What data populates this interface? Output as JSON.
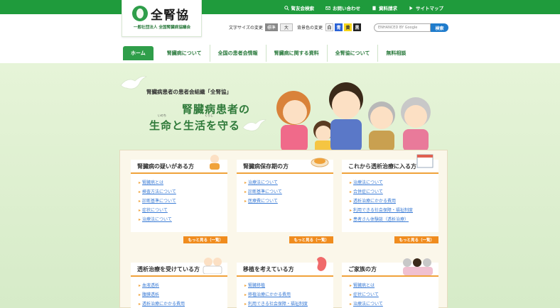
{
  "top_links": [
    {
      "label": "腎友会検索",
      "icon": "search-icon"
    },
    {
      "label": "お問い合わせ",
      "icon": "mail-icon"
    },
    {
      "label": "資料請求",
      "icon": "book-icon"
    },
    {
      "label": "サイトマップ",
      "icon": "arrow-icon"
    }
  ],
  "logo": {
    "title": "全腎協",
    "subtitle": "一般社団法人 全国腎臓病協議会"
  },
  "font_size": {
    "label": "文字サイズの変更",
    "options": [
      "標準",
      "大"
    ],
    "selected": "標準"
  },
  "bg_color": {
    "label": "背景色の変更",
    "options": [
      {
        "label": "白",
        "color": "#ffffff",
        "text": "#333333"
      },
      {
        "label": "青",
        "color": "#2a62d6",
        "text": "#ffffff"
      },
      {
        "label": "黄",
        "color": "#f5d51a",
        "text": "#333333"
      },
      {
        "label": "黒",
        "color": "#222222",
        "text": "#ffffff"
      }
    ]
  },
  "search": {
    "placeholder": "ENHANCED BY Google",
    "button": "検索"
  },
  "nav": [
    "ホーム",
    "腎臓病について",
    "全国の患者会情報",
    "腎臓病に関する資料",
    "全腎協について",
    "無料相談"
  ],
  "hero": {
    "tagline": "腎臓病患者の患者会組織「全腎協」",
    "title_line1": "腎臓病患者の",
    "title_line2": "生命と生活を守る",
    "ruby_inochi": "いのち",
    "ruby_kurashi": "くらし"
  },
  "cards": [
    {
      "title": "腎臓病の疑いがある方",
      "links": [
        "腎臓病とは",
        "検査方法について",
        "診断基準について",
        "症状について",
        "治療法について"
      ],
      "more": "もっと見る（一覧）"
    },
    {
      "title": "腎臓病保存期の方",
      "links": [
        "治療法について",
        "診断基準について",
        "医療費について"
      ],
      "more": "もっと見る（一覧）"
    },
    {
      "title": "これから透析治療に入る方",
      "links": [
        "治療法について",
        "合併症について",
        "透析治療にかかる費用",
        "利用できる社会保障・福祉制度",
        "患者さん体験談（透析治療）"
      ],
      "more": "もっと見る（一覧）"
    },
    {
      "title": "透析治療を受けている方",
      "links": [
        "血液透析",
        "腹膜透析",
        "透析治療にかかる費用"
      ]
    },
    {
      "title": "移植を考えている方",
      "links": [
        "腎臓移植",
        "移植治療にかかる費用",
        "利用できる社会保障・福祉制度"
      ]
    },
    {
      "title": "ご家族の方",
      "links": [
        "腎臓病とは",
        "症状について",
        "治療法について"
      ]
    }
  ],
  "colors": {
    "brand_green": "#1f9b3c",
    "accent_orange": "#f08c1e",
    "link_blue": "#3a7bd5"
  }
}
